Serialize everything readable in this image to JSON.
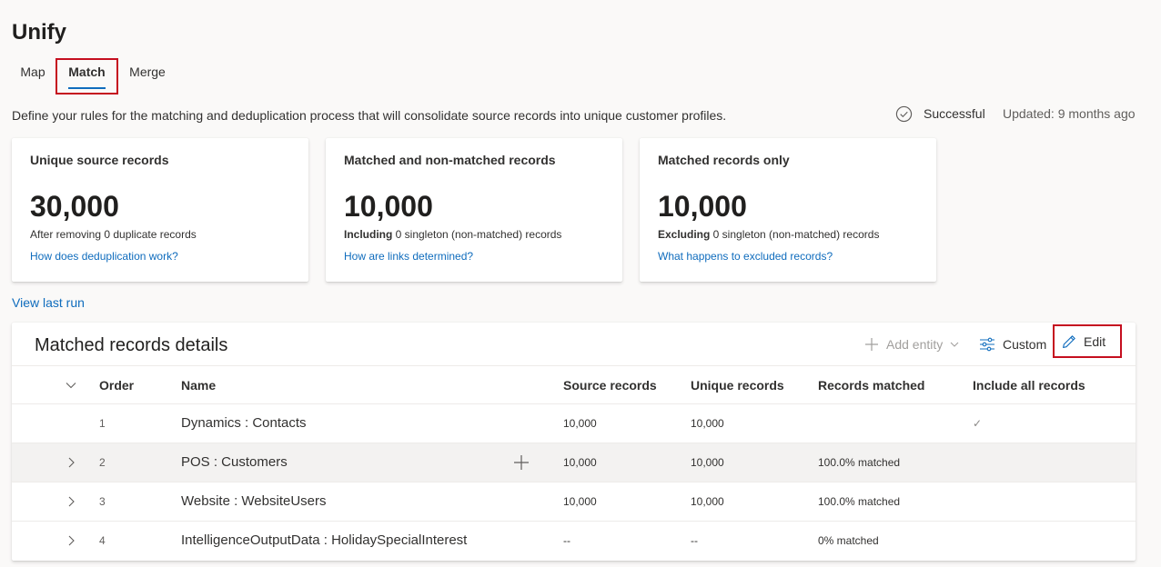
{
  "app": {
    "title": "Unify"
  },
  "tabs": [
    {
      "label": "Map"
    },
    {
      "label": "Match"
    },
    {
      "label": "Merge"
    }
  ],
  "description": "Define your rules for the matching and deduplication process that will consolidate source records into unique customer profiles.",
  "status": {
    "label": "Successful",
    "icon": "check-circle-icon",
    "updated": "Updated: 9 months ago"
  },
  "cards": [
    {
      "title": "Unique source records",
      "value": "30,000",
      "sub_bold": "",
      "sub_rest": "After removing 0 duplicate records",
      "link": "How does deduplication work?"
    },
    {
      "title": "Matched and non-matched records",
      "value": "10,000",
      "sub_bold": "Including",
      "sub_rest": " 0 singleton (non-matched) records",
      "link": "How are links determined?"
    },
    {
      "title": "Matched records only",
      "value": "10,000",
      "sub_bold": "Excluding",
      "sub_rest": " 0 singleton (non-matched) records",
      "link": "What happens to excluded records?"
    }
  ],
  "view_last_run": "View last run",
  "details": {
    "title": "Matched records details",
    "toolbar": {
      "add_entity": "Add entity",
      "custom": "Custom",
      "edit": "Edit"
    },
    "columns": [
      "Order",
      "Name",
      "Source records",
      "Unique records",
      "Records matched",
      "Include all records"
    ],
    "rows": [
      {
        "order": "1",
        "name": "Dynamics : Contacts",
        "source": "10,000",
        "unique": "10,000",
        "matched": "",
        "include_all": "✓"
      },
      {
        "order": "2",
        "name": "POS : Customers",
        "source": "10,000",
        "unique": "10,000",
        "matched": "100.0% matched",
        "include_all": ""
      },
      {
        "order": "3",
        "name": "Website : WebsiteUsers",
        "source": "10,000",
        "unique": "10,000",
        "matched": "100.0% matched",
        "include_all": ""
      },
      {
        "order": "4",
        "name": "IntelligenceOutputData : HolidaySpecialInterest",
        "source": "--",
        "unique": "--",
        "matched": "0% matched",
        "include_all": ""
      }
    ]
  },
  "colors": {
    "accent": "#0f6cbd",
    "highlight_border": "#c50f1f",
    "background": "#faf9f8"
  }
}
